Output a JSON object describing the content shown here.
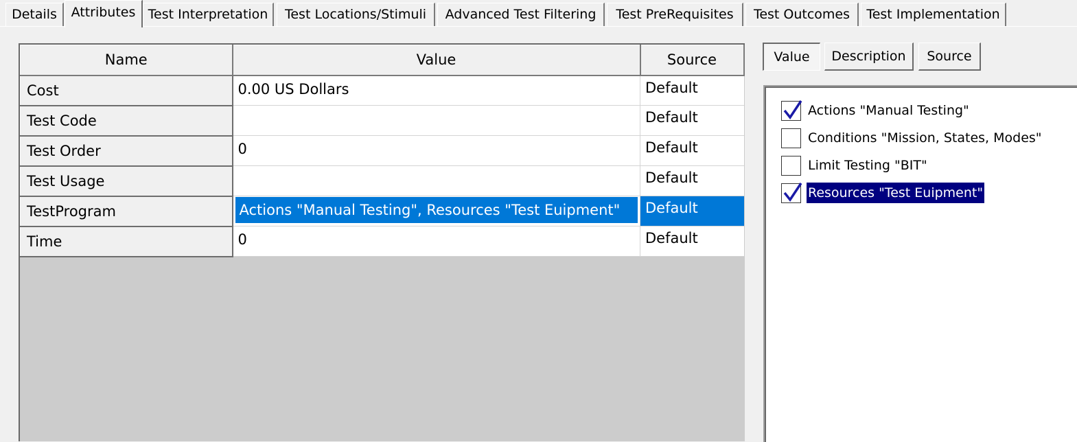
{
  "tabs": [
    "Details",
    "Attributes",
    "Test Interpretation",
    "Test Locations/Stimuli",
    "Advanced Test Filtering",
    "Test PreRequisites",
    "Test Outcomes",
    "Test Implementation"
  ],
  "active_tab": "Attributes",
  "grid": {
    "headers": {
      "name": "Name",
      "value": "Value",
      "source": "Source"
    },
    "rows": [
      {
        "name": "Cost",
        "value": "0.00 US Dollars",
        "source": "Default"
      },
      {
        "name": "Test Code",
        "value": "",
        "source": "Default"
      },
      {
        "name": "Test Order",
        "value": "0",
        "source": "Default"
      },
      {
        "name": "Test Usage",
        "value": "",
        "source": "Default"
      },
      {
        "name": "TestProgram",
        "value": "Actions \"Manual Testing\", Resources \"Test Euipment\"",
        "source": "Default"
      },
      {
        "name": "Time",
        "value": "0",
        "source": "Default"
      }
    ],
    "selected_row": "TestProgram"
  },
  "panel": {
    "buttons": {
      "value": "Value",
      "description": "Description",
      "source": "Source"
    },
    "pressed_button": "Value",
    "items": [
      {
        "label": "Actions \"Manual Testing\"",
        "checked": true
      },
      {
        "label": "Conditions \"Mission, States, Modes\"",
        "checked": false
      },
      {
        "label": "Limit Testing \"BIT\"",
        "checked": false
      },
      {
        "label": "Resources \"Test Euipment\"",
        "checked": true
      }
    ],
    "highlighted_item": "Resources \"Test Euipment\""
  },
  "colors": {
    "selection_blue": "#0078d7",
    "highlight_navy": "#000080",
    "check_mark": "#1a1aa6",
    "grid_empty": "#cccccc"
  }
}
